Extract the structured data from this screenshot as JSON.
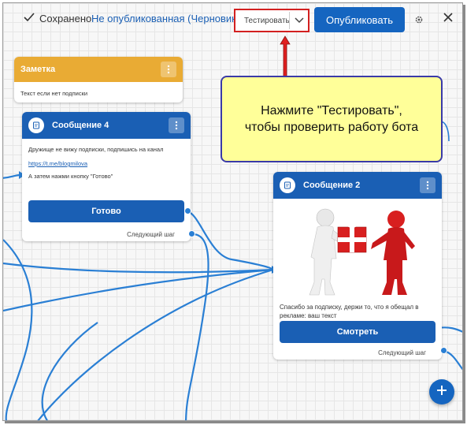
{
  "toolbar": {
    "saved_label": "Сохранено",
    "status_label": "Не опубликованная (Черновик)",
    "test_label": "Тестировать",
    "publish_label": "Опубликовать"
  },
  "callout": {
    "line1": "Нажмите \"Тестировать\",",
    "line2": "чтобы проверить работу бота"
  },
  "note_card": {
    "title": "Заметка",
    "text": "Текст если нет подписки"
  },
  "message4": {
    "title": "Сообщение 4",
    "text1": "Дружище не вижу подписки, подпишись на канал",
    "link": "https://t.me/blogmilova",
    "text2": "А затем нажми кнопку \"Готово\"",
    "button": "Готово",
    "next_step": "Следующий шаг"
  },
  "message2": {
    "title": "Сообщение 2",
    "text": "Спасибо за подписку, держи то, что я обещал в рекламе: ваш текст",
    "button": "Смотреть",
    "next_step": "Следующий шаг"
  },
  "colors": {
    "primary": "#1a5fb4",
    "note": "#e9ab34",
    "highlight": "#d32020",
    "callout_bg": "#ffff99"
  },
  "icons": [
    "check-icon",
    "chevron-down-icon",
    "gear-icon",
    "close-icon",
    "kebab-icon",
    "message-avatar-icon",
    "plus-icon",
    "arrow-up-icon"
  ]
}
